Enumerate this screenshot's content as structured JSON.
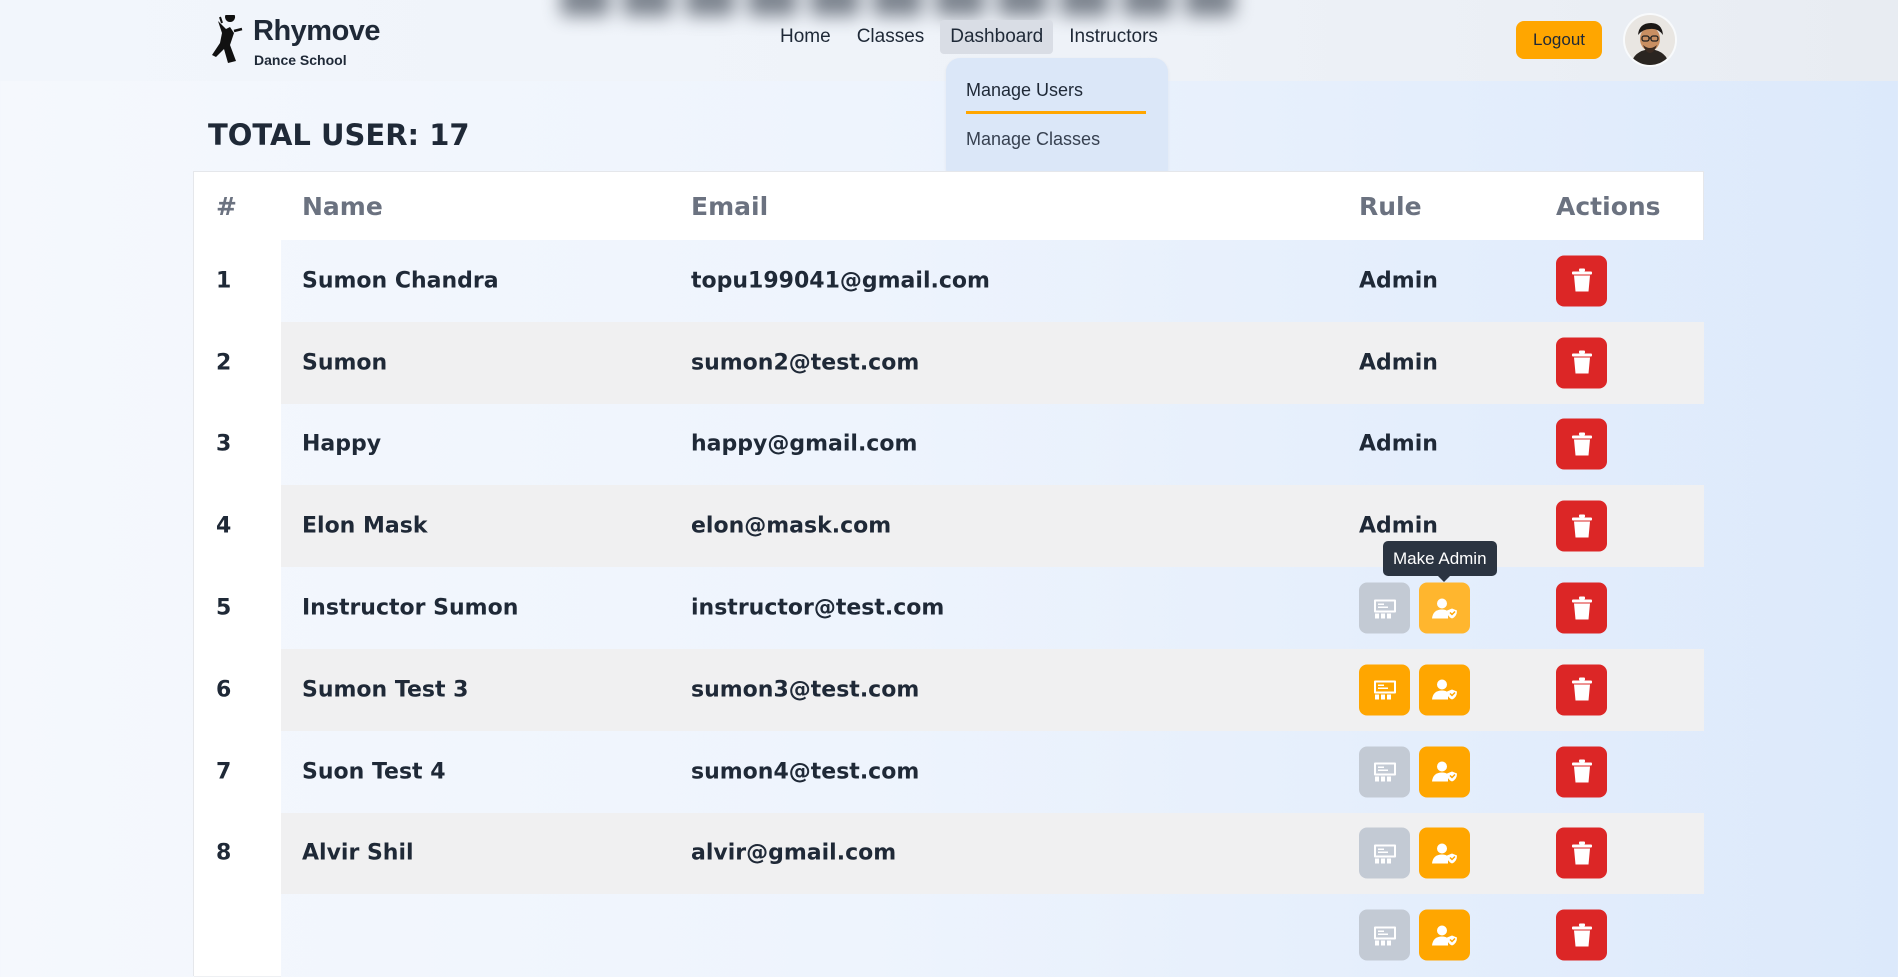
{
  "brand": {
    "name": "Rhymove",
    "tagline": "Dance School"
  },
  "nav": {
    "links": [
      {
        "label": "Home",
        "active": false
      },
      {
        "label": "Classes",
        "active": false
      },
      {
        "label": "Dashboard",
        "active": true
      },
      {
        "label": "Instructors",
        "active": false
      }
    ],
    "logout_label": "Logout"
  },
  "dropdown": {
    "items": [
      "Manage Users",
      "Manage Classes"
    ]
  },
  "summary": {
    "total_text": "TOTAL USER: 17"
  },
  "table": {
    "headers": [
      "#",
      "Name",
      "Email",
      "Rule",
      "Actions"
    ],
    "rows": [
      {
        "num": "1",
        "name": "Sumon Chandra",
        "email": "topu199041@gmail.com",
        "rule": "Admin"
      },
      {
        "num": "2",
        "name": "Sumon",
        "email": "sumon2@test.com",
        "rule": "Admin"
      },
      {
        "num": "3",
        "name": "Happy",
        "email": "happy@gmail.com",
        "rule": "Admin"
      },
      {
        "num": "4",
        "name": "Elon Mask",
        "email": "elon@mask.com",
        "rule": "Admin"
      },
      {
        "num": "5",
        "name": "Instructor Sumon",
        "email": "instructor@test.com",
        "rule": "",
        "instructor_btn": "disabled"
      },
      {
        "num": "6",
        "name": "Sumon Test 3",
        "email": "sumon3@test.com",
        "rule": "",
        "instructor_btn": "enabled"
      },
      {
        "num": "7",
        "name": "Suon Test 4",
        "email": "sumon4@test.com",
        "rule": "",
        "instructor_btn": "disabled"
      },
      {
        "num": "8",
        "name": "Alvir Shil",
        "email": "alvir@gmail.com",
        "rule": "",
        "instructor_btn": "disabled"
      },
      {
        "num": "",
        "name": "",
        "email": "",
        "rule": "",
        "instructor_btn": "disabled"
      }
    ]
  },
  "tooltip": {
    "text": "Make Admin"
  },
  "colors": {
    "accent": "#ffa600",
    "danger": "#dc2626",
    "disabled": "#c3cad4",
    "tooltip_bg": "#2b3441"
  },
  "icons": {
    "delete": "trash-icon",
    "make_instructor": "classroom-icon",
    "make_admin": "user-shield-icon"
  }
}
